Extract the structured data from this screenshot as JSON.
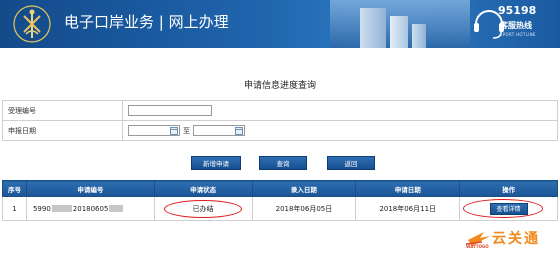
{
  "header": {
    "title": "电子口岸业务 | 网上办理",
    "hotline_number": "95198",
    "hotline_label": "客服热线",
    "hotline_sub": "EPORT HOTLINE"
  },
  "page_heading": "申请信息进度查询",
  "form": {
    "accept_no_label": "受理编号",
    "accept_no_value": "",
    "apply_date_label": "申报日期",
    "date_from": "",
    "date_to_sep": "至",
    "date_to": ""
  },
  "buttons": {
    "new_apply": "新增申请",
    "query": "查询",
    "back": "返回"
  },
  "table": {
    "headers": [
      "序号",
      "申请编号",
      "申请状态",
      "录入日期",
      "申请日期",
      "操作"
    ],
    "rows": [
      {
        "index": "1",
        "apply_no_prefix": "5990",
        "apply_no_mid": "20180605",
        "status": "已办结",
        "entry_date": "2018年06月05日",
        "apply_date": "2018年06月11日",
        "action": "查看详情"
      }
    ]
  },
  "watermark": {
    "text": "云关通",
    "sub": "WAYTOGO"
  },
  "colors": {
    "banner_blue": "#1f64ad",
    "header_row_blue": "#2d6db0",
    "highlight_red": "#e01b1b",
    "watermark_orange": "#f08a1c"
  }
}
